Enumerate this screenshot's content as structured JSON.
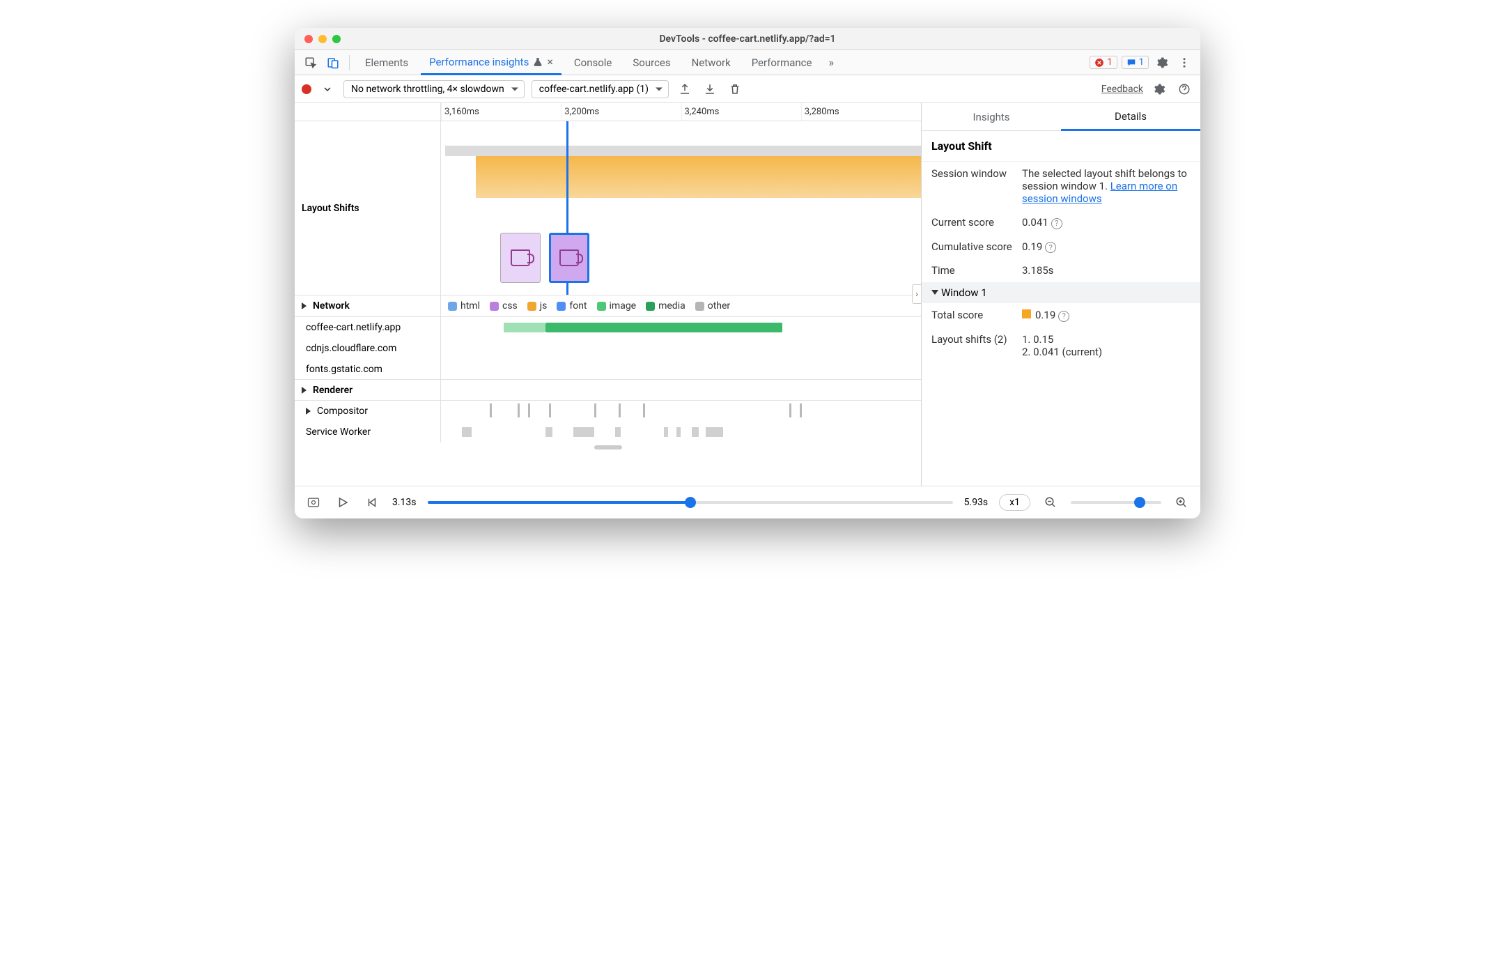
{
  "window": {
    "title": "DevTools - coffee-cart.netlify.app/?ad=1"
  },
  "tabs": {
    "elements": "Elements",
    "perf_insights": "Performance insights",
    "console": "Console",
    "sources": "Sources",
    "network": "Network",
    "performance": "Performance"
  },
  "badges": {
    "errors": "1",
    "messages": "1"
  },
  "toolbar": {
    "throttling": "No network throttling, 4× slowdown",
    "page_select": "coffee-cart.netlify.app (1)",
    "feedback": "Feedback"
  },
  "timeline": {
    "ticks": [
      "3,160ms",
      "3,200ms",
      "3,240ms",
      "3,280ms"
    ],
    "layout_shifts_label": "Layout Shifts",
    "network_label": "Network",
    "renderer_label": "Renderer",
    "compositor_label": "Compositor",
    "service_worker_label": "Service Worker",
    "legend": {
      "html": "html",
      "css": "css",
      "js": "js",
      "font": "font",
      "image": "image",
      "media": "media",
      "other": "other"
    },
    "hosts": [
      "coffee-cart.netlify.app",
      "cdnjs.cloudflare.com",
      "fonts.gstatic.com"
    ]
  },
  "details": {
    "insights_tab": "Insights",
    "details_tab": "Details",
    "title": "Layout Shift",
    "session_window_label": "Session window",
    "session_window_desc": "The selected layout shift belongs to session window 1. ",
    "learn_more": "Learn more on session windows",
    "current_score_label": "Current score",
    "current_score": "0.041",
    "cumulative_label": "Cumulative score",
    "cumulative": "0.19",
    "time_label": "Time",
    "time": "3.185s",
    "window1": "Window 1",
    "total_score_label": "Total score",
    "total_score": "0.19",
    "shifts_label": "Layout shifts (2)",
    "shift1": "1. 0.15",
    "shift2": "2. 0.041 (current)"
  },
  "footer": {
    "start": "3.13s",
    "end": "5.93s",
    "speed": "x1"
  },
  "colors": {
    "html": "#6ea6e8",
    "css": "#b980e0",
    "js": "#f0a732",
    "font": "#4f8ef7",
    "image": "#4ec777",
    "media": "#2aa05a",
    "other": "#b5b5b5"
  }
}
